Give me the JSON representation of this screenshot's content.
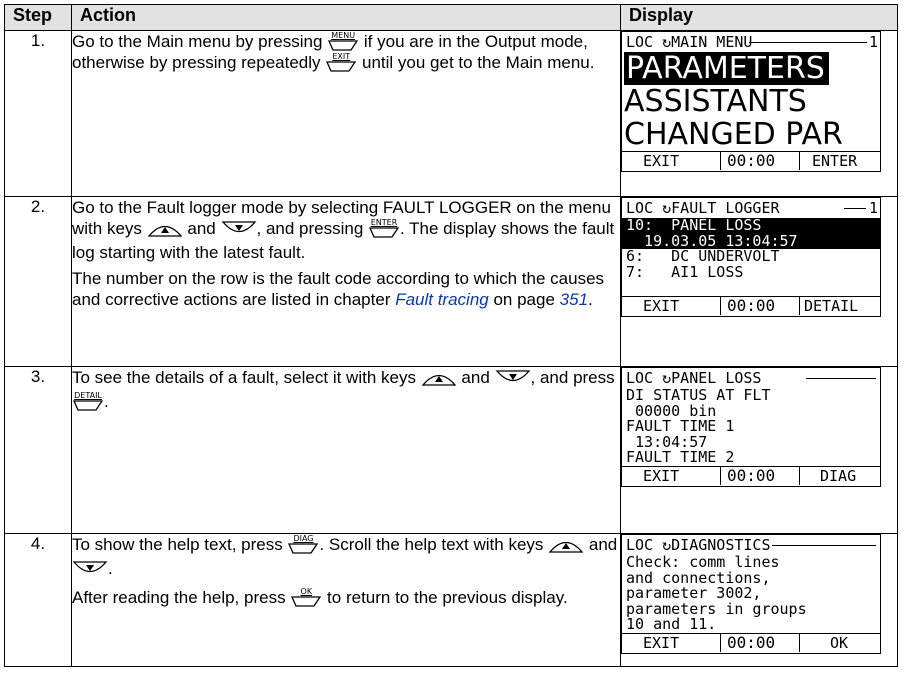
{
  "headers": {
    "step": "Step",
    "action": "Action",
    "display": "Display"
  },
  "keys": {
    "menu": "MENU",
    "exit": "EXIT",
    "enter": "ENTER",
    "detail": "DETAIL",
    "diag": "DIAG",
    "ok": "OK"
  },
  "rows": [
    {
      "step": "1.",
      "t1": "Go to the Main menu by pressing",
      "t2": "if you are in the Output mode, otherwise by pressing repeatedly",
      "t3": "until you get to the Main menu.",
      "lcd": {
        "header": "LOC ↻MAIN MENU",
        "page_num": "1",
        "lines": [
          "PARAMETERS",
          "ASSISTANTS",
          "CHANGED PAR"
        ],
        "foot_left": "EXIT",
        "foot_mid": "00:00",
        "foot_right": "ENTER"
      }
    },
    {
      "step": "2.",
      "t1": "Go to the Fault logger mode by selecting FAULT LOGGER on the menu with keys",
      "t2": "and",
      "t3": ", and pressing",
      "t4": ". The display shows the fault log starting with the latest fault.",
      "p2_a": "The number on the row is the fault code according to which the causes and corrective actions are listed in chapter",
      "p2_link": "Fault tracing",
      "p2_b": "on page",
      "p2_page": "351",
      "p2_c": ".",
      "lcd": {
        "header": "LOC ↻FAULT LOGGER",
        "page_num": "1",
        "sel1": "10:  PANEL LOSS",
        "sel2": "  19.03.05 13:04:57",
        "line3": "6:   DC UNDERVOLT",
        "line4": "7:   AI1 LOSS",
        "foot_left": "EXIT",
        "foot_mid": "00:00",
        "foot_right": "DETAIL"
      }
    },
    {
      "step": "3.",
      "t1": "To see the details of a fault, select it with keys",
      "t2": "and",
      "t3": ", and press",
      "t4": ".",
      "lcd": {
        "header": "LOC ↻PANEL LOSS",
        "lines": [
          "DI STATUS AT FLT",
          " 00000 bin",
          "FAULT TIME 1",
          " 13:04:57",
          "FAULT TIME 2"
        ],
        "foot_left": "EXIT",
        "foot_mid": "00:00",
        "foot_right": "DIAG"
      }
    },
    {
      "step": "4.",
      "t1": "To show the help text, press",
      "t2": ". Scroll the help text with keys",
      "t3": "and",
      "t4": ".",
      "p2_a": "After reading the help, press",
      "p2_b": "to return to the previous display.",
      "lcd": {
        "header": "LOC ↻DIAGNOSTICS",
        "lines": [
          "Check: comm lines",
          "and connections,",
          "parameter 3002,",
          "parameters in groups",
          "10 and 11."
        ],
        "foot_left": "EXIT",
        "foot_mid": "00:00",
        "foot_right": "OK"
      }
    }
  ]
}
